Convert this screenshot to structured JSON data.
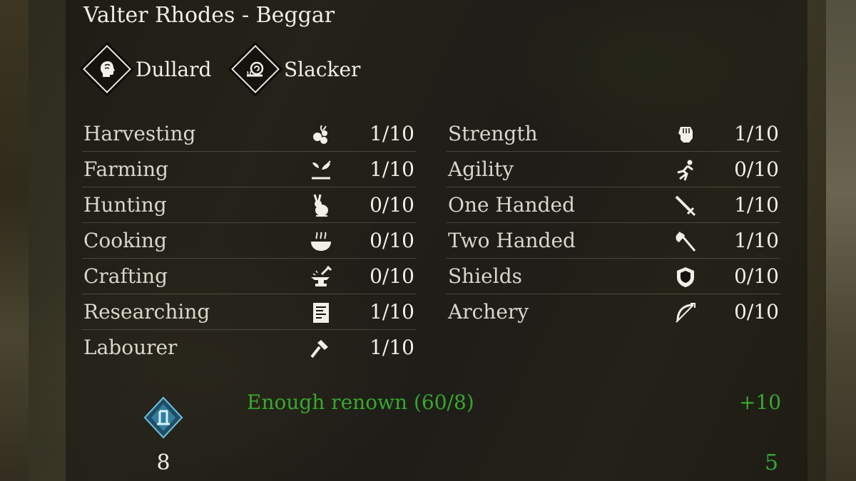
{
  "character": {
    "title": "Valter Rhodes - Beggar"
  },
  "traits": [
    {
      "label": "Dullard",
      "icon": "head-icon"
    },
    {
      "label": "Slacker",
      "icon": "snail-icon"
    }
  ],
  "skills_left": [
    {
      "name": "Harvesting",
      "icon": "berries-icon",
      "value": "1/10"
    },
    {
      "name": "Farming",
      "icon": "sprout-icon",
      "value": "1/10"
    },
    {
      "name": "Hunting",
      "icon": "rabbit-icon",
      "value": "0/10"
    },
    {
      "name": "Cooking",
      "icon": "bowl-icon",
      "value": "0/10"
    },
    {
      "name": "Crafting",
      "icon": "anvil-icon",
      "value": "0/10"
    },
    {
      "name": "Researching",
      "icon": "document-icon",
      "value": "1/10"
    },
    {
      "name": "Labourer",
      "icon": "hammer-icon",
      "value": "1/10"
    }
  ],
  "skills_right": [
    {
      "name": "Strength",
      "icon": "fist-icon",
      "value": "1/10"
    },
    {
      "name": "Agility",
      "icon": "running-icon",
      "value": "0/10"
    },
    {
      "name": "One Handed",
      "icon": "sword-icon",
      "value": "1/10"
    },
    {
      "name": "Two Handed",
      "icon": "axe-icon",
      "value": "1/10"
    },
    {
      "name": "Shields",
      "icon": "shield-icon",
      "value": "0/10"
    },
    {
      "name": "Archery",
      "icon": "bow-icon",
      "value": "0/10"
    }
  ],
  "renown": {
    "status": "Enough renown (60/8)",
    "bonus": "+10",
    "cost": "8",
    "points": "5"
  },
  "colors": {
    "text": "#f1efe8",
    "label": "#d9d6cc",
    "positive": "#36a82d",
    "renown_icon": "#4fa7c9"
  }
}
